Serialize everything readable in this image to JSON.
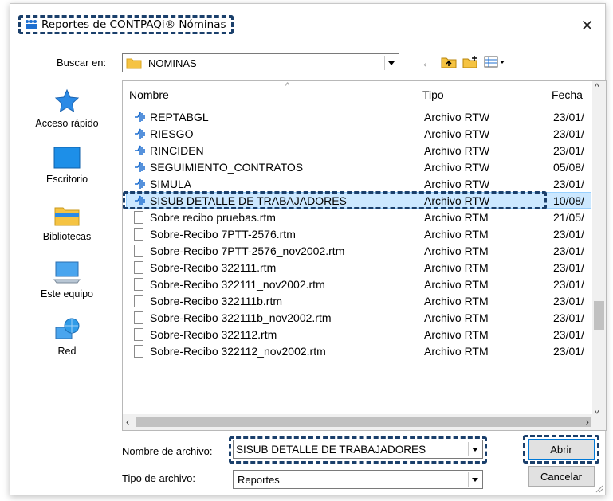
{
  "window": {
    "title": "Reportes de CONTPAQi® Nóminas",
    "close_glyph": "×"
  },
  "lookin": {
    "label": "Buscar en:",
    "value": "NOMINAS"
  },
  "nav": [
    {
      "label": "Acceso rápido",
      "icon": "star-icon"
    },
    {
      "label": "Escritorio",
      "icon": "desktop-icon"
    },
    {
      "label": "Bibliotecas",
      "icon": "libraries-icon"
    },
    {
      "label": "Este equipo",
      "icon": "computer-icon"
    },
    {
      "label": "Red",
      "icon": "network-icon"
    }
  ],
  "columns": {
    "name": "Nombre",
    "type": "Tipo",
    "date": "Fecha"
  },
  "files": [
    {
      "name": "REPTABGL",
      "type": "Archivo RTW",
      "date": "23/01/",
      "icon": "rtw"
    },
    {
      "name": "RIESGO",
      "type": "Archivo RTW",
      "date": "23/01/",
      "icon": "rtw"
    },
    {
      "name": "RINCIDEN",
      "type": "Archivo RTW",
      "date": "23/01/",
      "icon": "rtw"
    },
    {
      "name": "SEGUIMIENTO_CONTRATOS",
      "type": "Archivo RTW",
      "date": "05/08/",
      "icon": "rtw"
    },
    {
      "name": "SIMULA",
      "type": "Archivo RTW",
      "date": "23/01/",
      "icon": "rtw"
    },
    {
      "name": "SISUB DETALLE DE TRABAJADORES",
      "type": "Archivo RTW",
      "date": "10/08/",
      "icon": "rtw",
      "selected": true
    },
    {
      "name": "Sobre recibo pruebas.rtm",
      "type": "Archivo RTM",
      "date": "21/05/",
      "icon": "rtm"
    },
    {
      "name": "Sobre-Recibo 7PTT-2576.rtm",
      "type": "Archivo RTM",
      "date": "23/01/",
      "icon": "rtm"
    },
    {
      "name": "Sobre-Recibo 7PTT-2576_nov2002.rtm",
      "type": "Archivo RTM",
      "date": "23/01/",
      "icon": "rtm"
    },
    {
      "name": "Sobre-Recibo 322111.rtm",
      "type": "Archivo RTM",
      "date": "23/01/",
      "icon": "rtm"
    },
    {
      "name": "Sobre-Recibo 322111_nov2002.rtm",
      "type": "Archivo RTM",
      "date": "23/01/",
      "icon": "rtm"
    },
    {
      "name": "Sobre-Recibo 322111b.rtm",
      "type": "Archivo RTM",
      "date": "23/01/",
      "icon": "rtm"
    },
    {
      "name": "Sobre-Recibo 322111b_nov2002.rtm",
      "type": "Archivo RTM",
      "date": "23/01/",
      "icon": "rtm"
    },
    {
      "name": "Sobre-Recibo 322112.rtm",
      "type": "Archivo RTM",
      "date": "23/01/",
      "icon": "rtm"
    },
    {
      "name": "Sobre-Recibo 322112_nov2002.rtm",
      "type": "Archivo RTM",
      "date": "23/01/",
      "icon": "rtm"
    }
  ],
  "filename": {
    "label": "Nombre de archivo:",
    "value": "SISUB DETALLE DE TRABAJADORES"
  },
  "filetype": {
    "label": "Tipo de archivo:",
    "value": "Reportes"
  },
  "buttons": {
    "open": "Abrir",
    "cancel": "Cancelar"
  },
  "colors": {
    "highlight": "#1a3f6b",
    "selection": "#cce8ff",
    "folder": "#f5c342"
  }
}
